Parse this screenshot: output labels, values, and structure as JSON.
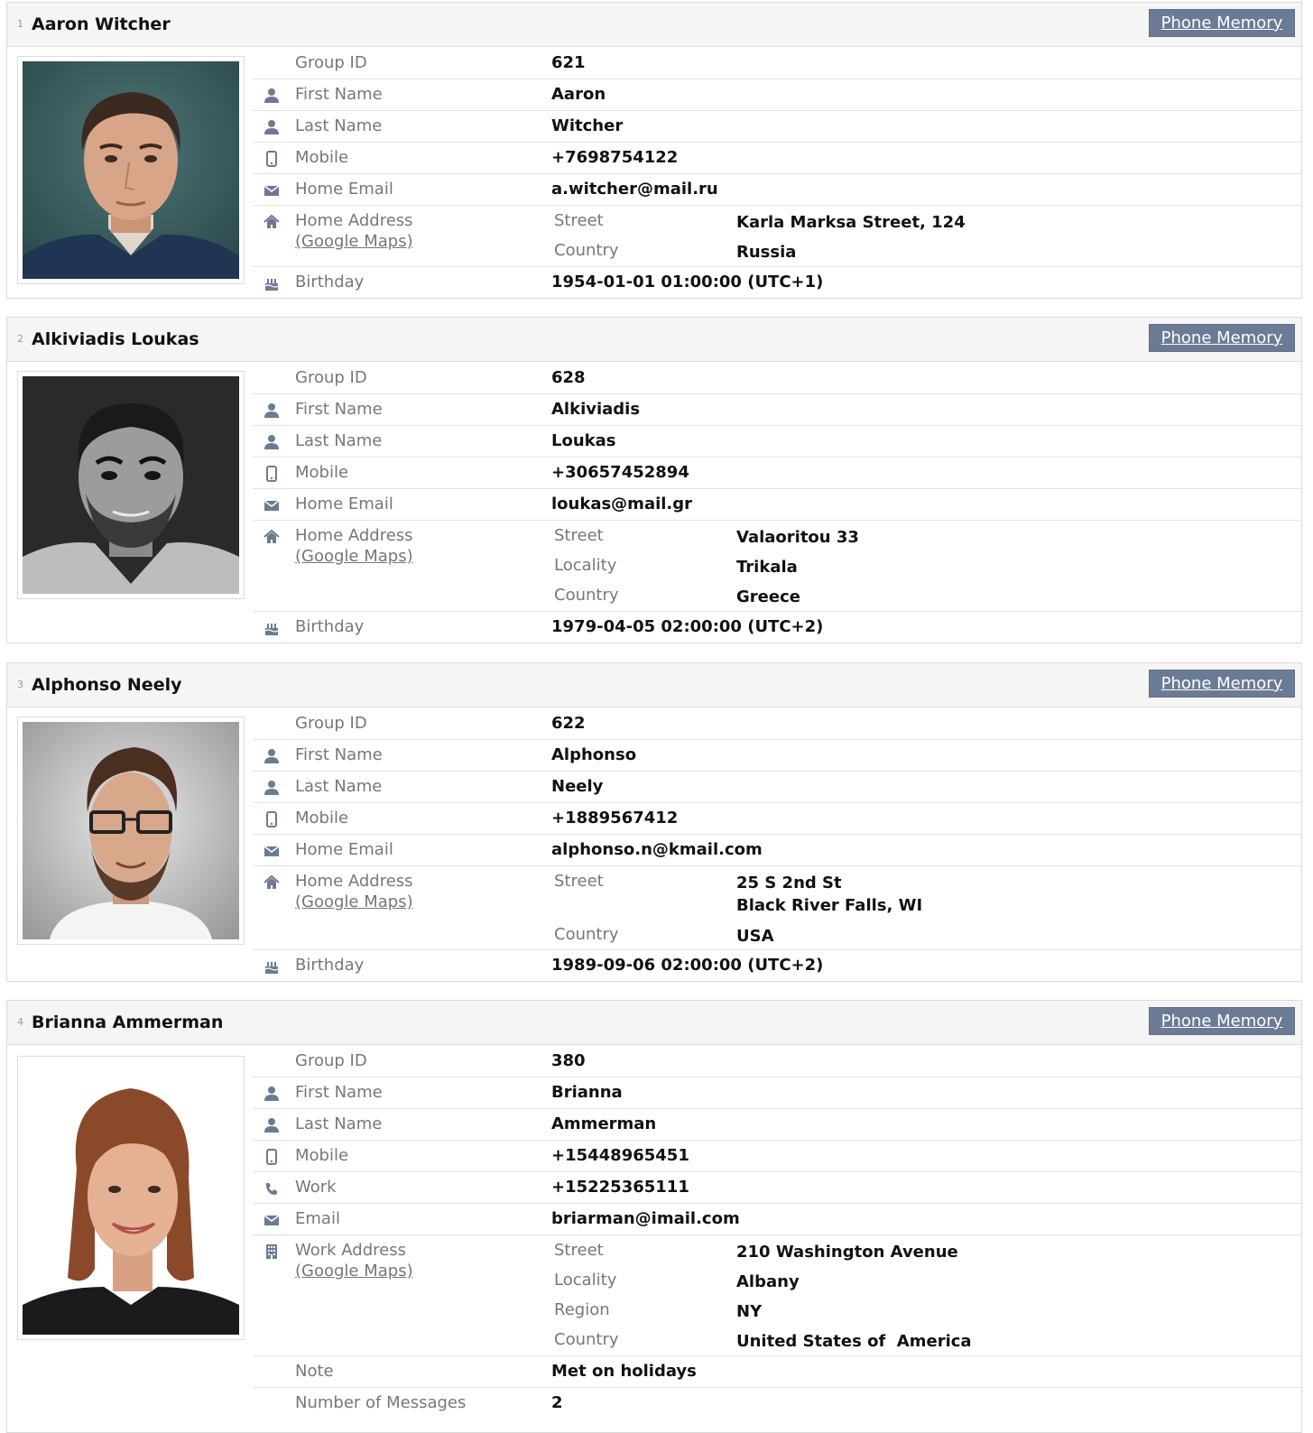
{
  "button_label": "Phone Memory",
  "maps_label": "(Google Maps)",
  "labels": {
    "group_id": "Group ID",
    "first_name": "First Name",
    "last_name": "Last Name",
    "mobile": "Mobile",
    "work": "Work",
    "home_email": "Home Email",
    "email": "Email",
    "home_address": "Home Address",
    "work_address": "Work Address",
    "birthday": "Birthday",
    "note": "Note",
    "messages": "Number of Messages",
    "street": "Street",
    "locality": "Locality",
    "region": "Region",
    "country": "Country"
  },
  "contacts": [
    {
      "index": "1",
      "name": "Aaron Witcher",
      "group_id": "621",
      "first_name": "Aaron",
      "last_name": "Witcher",
      "mobile": "+7698754122",
      "home_email": "a.witcher@mail.ru",
      "street": "Karla Marksa Street, 124",
      "country": "Russia",
      "birthday": "1954-01-01 01:00:00 (UTC+1)"
    },
    {
      "index": "2",
      "name": "Alkiviadis Loukas",
      "group_id": "628",
      "first_name": "Alkiviadis",
      "last_name": "Loukas",
      "mobile": "+30657452894",
      "home_email": "loukas@mail.gr",
      "street": "Valaoritou 33",
      "locality": "Trikala",
      "country": "Greece",
      "birthday": "1979-04-05 02:00:00 (UTC+2)"
    },
    {
      "index": "3",
      "name": "Alphonso Neely",
      "group_id": "622",
      "first_name": "Alphonso",
      "last_name": "Neely",
      "mobile": "+1889567412",
      "home_email": "alphonso.n@kmail.com",
      "street_line1": "25 S 2nd St",
      "street_line2": "Black River Falls, WI",
      "country": "USA",
      "birthday": "1989-09-06 02:00:00 (UTC+2)"
    },
    {
      "index": "4",
      "name": "Brianna Ammerman",
      "group_id": "380",
      "first_name": "Brianna",
      "last_name": "Ammerman",
      "mobile": "+15448965451",
      "work": "+15225365111",
      "email": "briarman@imail.com",
      "street": "210 Washington Avenue",
      "locality": "Albany",
      "region": "NY",
      "country": "United States of  America",
      "note": "Met on holidays",
      "messages": "2"
    }
  ],
  "icons": {
    "person": "person-icon",
    "mobile": "mobile-phone-icon",
    "phone": "phone-handset-icon",
    "email": "envelope-icon",
    "home": "home-icon",
    "building": "building-icon",
    "birthday": "birthday-cake-icon"
  },
  "colors": {
    "icon": "#6b7b95",
    "button": "#6b7b95",
    "label": "#777777",
    "header_bg": "#f5f5f5"
  }
}
